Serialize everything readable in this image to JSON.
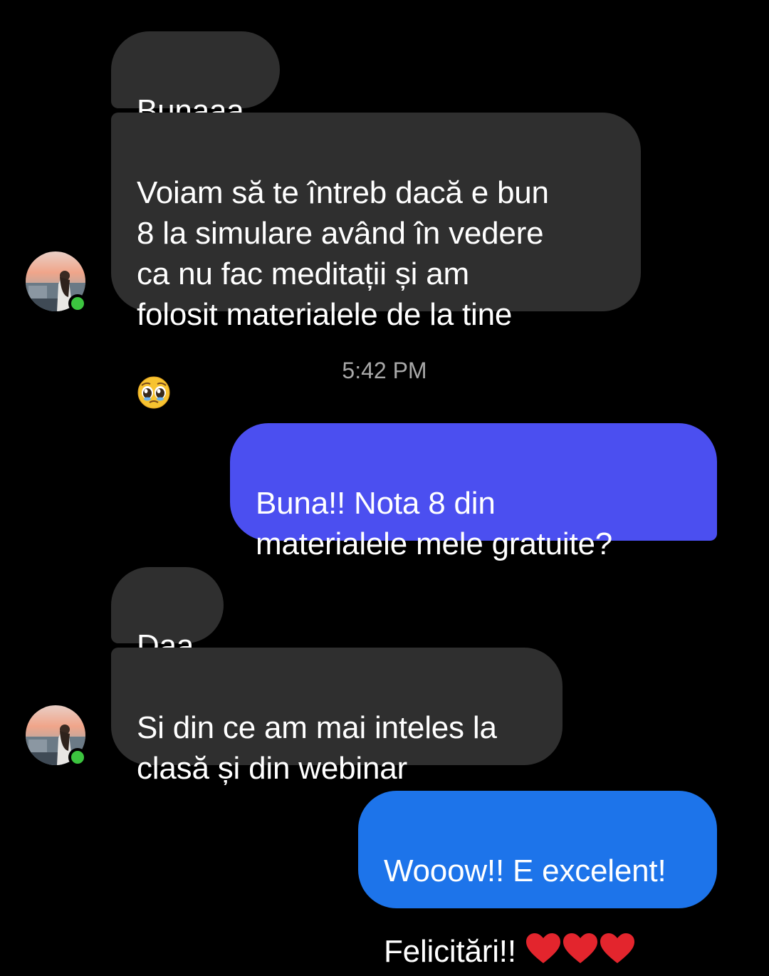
{
  "conversation": {
    "messages": [
      {
        "sender": "contact",
        "text": "Bunaaa"
      },
      {
        "sender": "contact",
        "text": "Voiam să te întreb dacă e bun\n8 la simulare având în vedere\nca nu fac meditații și am\nfolosit materialele de la tine",
        "emoji": "pleading-face"
      },
      {
        "sender": "me",
        "text": "Buna!! Nota 8 din\nmaterialele mele gratuite?"
      },
      {
        "sender": "contact",
        "text": "Daa"
      },
      {
        "sender": "contact",
        "text": "Si din ce am mai inteles la\nclasă și din webinar"
      },
      {
        "sender": "me",
        "text": "Wooow!! E excelent!\nFelicitări!! ",
        "emoji": "red-heart x3"
      }
    ],
    "timestamp": "5:42 PM"
  },
  "colors": {
    "incoming_bubble": "#2f2f2f",
    "outgoing_bubble_top": "#4a4ef0",
    "outgoing_bubble_bottom": "#1d74ea",
    "online_indicator": "#3cc43f",
    "timestamp_text": "#a8a8a8"
  },
  "icons": {
    "avatar": "contact-avatar",
    "online": "online-status-dot",
    "emoji_1": "pleading-face-emoji",
    "emoji_2": "red-heart-emoji"
  }
}
